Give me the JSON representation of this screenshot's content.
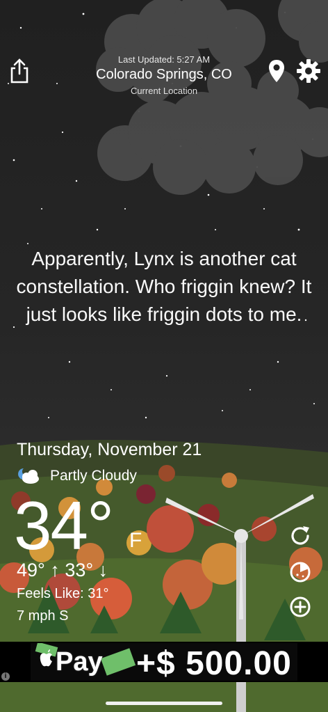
{
  "header": {
    "last_updated": "Last Updated: 5:27 AM",
    "city": "Colorado Springs, CO",
    "location_label": "Current Location"
  },
  "quote": "Apparently, Lynx is another cat constellation. Who friggin knew? It just looks like friggin dots to me.",
  "weather": {
    "date": "Thursday, November 21",
    "condition": "Partly Cloudy",
    "condition_icon": "partly-cloudy-night-icon",
    "temperature": "34°",
    "unit": "F",
    "high_low": "49° ↑ 33° ↓",
    "feels_like": "Feels Like: 31°",
    "wind": "7 mph S"
  },
  "actions": {
    "share_icon": "share-icon",
    "location_icon": "location-pin-icon",
    "settings_icon": "gear-icon",
    "refresh_icon": "refresh-icon",
    "radar_icon": "radar-icon",
    "add_icon": "add-icon"
  },
  "ad": {
    "pay_text": "Pay",
    "amount": "+$ 500.00",
    "info": "i"
  },
  "colors": {
    "sky": "#222222",
    "cloud": "#555555",
    "hill": "#3b4a2a",
    "text": "#ffffff"
  }
}
